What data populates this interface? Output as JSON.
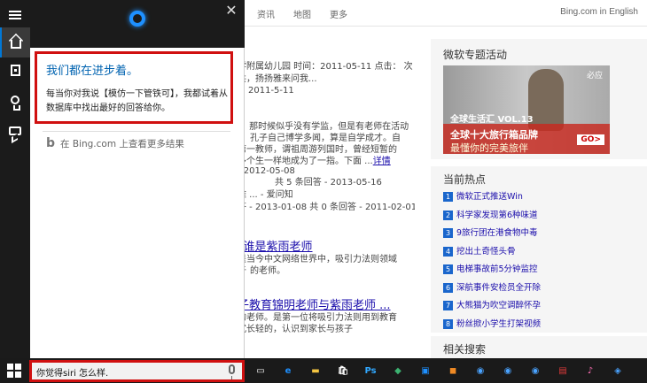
{
  "bing": {
    "tabs": [
      "资讯",
      "地图",
      "更多"
    ],
    "intl_link": "Bing.com in English",
    "results": [
      {
        "line": "学附属幼儿园 时间：2011-05-11 点击： 次"
      },
      {
        "line": "共，扬扬雅来问我..."
      },
      {
        "date": "2011-5-11"
      },
      {
        "line": "。 那时候似乎没有学监，但是有老师在活动"
      },
      {
        "line": "孔子自己博学多闻，算是自学成才。自"
      },
      {
        "line": "第一教师，谓祖周游列国时，曾经短暂的"
      },
      {
        "line": "多个生一样地成为了一指。下面 ...",
        "more": "详情"
      },
      {
        "meta": "- 2012-05-08"
      },
      {
        "meta": "共 5 条回答 - 2013-05-16"
      },
      {
        "link": "雅 ... - 爱问知"
      },
      {
        "meta": "答 - 2013-01-08    共 0 条回答 - 2011-02-01"
      }
    ],
    "result2_title": "_谁是紫雨老师",
    "result2_lines": [
      "是当今中文网络世界中，吸引力法则领域",
      "于",
      "的老师。"
    ],
    "result3_title": "子教育锦明老师与紫雨老师 ...",
    "result3_lines": [
      "的老师。是第一位将吸引力法则用到教育",
      "式长轻的，认识到家长与孩子"
    ],
    "promo": {
      "heading": "微软专题活动",
      "logo": "必应",
      "vol": "全球生活汇 VOL.13",
      "line1": "全球十大旅行箱品牌",
      "line2": "最懂你的完美旅伴",
      "go": "GO>"
    },
    "hot": {
      "heading": "当前热点",
      "items": [
        {
          "num": "1",
          "text": "微软正式推送Win"
        },
        {
          "num": "2",
          "text": "科学家发现第6种味道"
        },
        {
          "num": "3",
          "text": "9旅行团在港食物中毒"
        },
        {
          "num": "4",
          "text": "挖出土奇怪头骨"
        },
        {
          "num": "5",
          "text": "电梯事故前5分钟监控"
        },
        {
          "num": "6",
          "text": "深航事件安检员全开除"
        },
        {
          "num": "7",
          "text": "大熊猫为吹空调醉怀孕"
        },
        {
          "num": "8",
          "text": "粉丝掀小学生打架视频"
        }
      ]
    },
    "related_heading": "相关搜索"
  },
  "cortana": {
    "answer_title": "我们都在进步着。",
    "answer_text": "每当你对我说【模仿一下管铁可】，我都试着从数据库中找出最好的回答给你。",
    "bing_more": "在 Bing.com 上查看更多结果",
    "close_glyph": "✕"
  },
  "taskbar": {
    "search_text": "你觉得siri 怎么样.",
    "icons": [
      {
        "name": "task-view-icon",
        "color": "#ffffff",
        "glyph": "▭"
      },
      {
        "name": "edge-icon",
        "color": "#1e90ff",
        "glyph": "e"
      },
      {
        "name": "file-explorer-icon",
        "color": "#f4c542",
        "glyph": "▬"
      },
      {
        "name": "store-icon",
        "color": "#ffffff",
        "glyph": "🛍"
      },
      {
        "name": "photoshop-icon",
        "color": "#31a8ff",
        "glyph": "Ps"
      },
      {
        "name": "app-icon-green",
        "color": "#3cb371",
        "glyph": "◆"
      },
      {
        "name": "app-icon-blue",
        "color": "#1e90ff",
        "glyph": "▣"
      },
      {
        "name": "app-icon-orange",
        "color": "#f08a24",
        "glyph": "◼"
      },
      {
        "name": "app-icon-circle-1",
        "color": "#4aa3ff",
        "glyph": "◉"
      },
      {
        "name": "app-icon-circle-2",
        "color": "#4aa3ff",
        "glyph": "◉"
      },
      {
        "name": "app-icon-circle-3",
        "color": "#4aa3ff",
        "glyph": "◉"
      },
      {
        "name": "app-icon-red",
        "color": "#e03a3a",
        "glyph": "▤"
      },
      {
        "name": "itunes-icon",
        "color": "#ff6fb5",
        "glyph": "♪"
      },
      {
        "name": "app-icon-last",
        "color": "#4aa3ff",
        "glyph": "◈"
      }
    ]
  }
}
